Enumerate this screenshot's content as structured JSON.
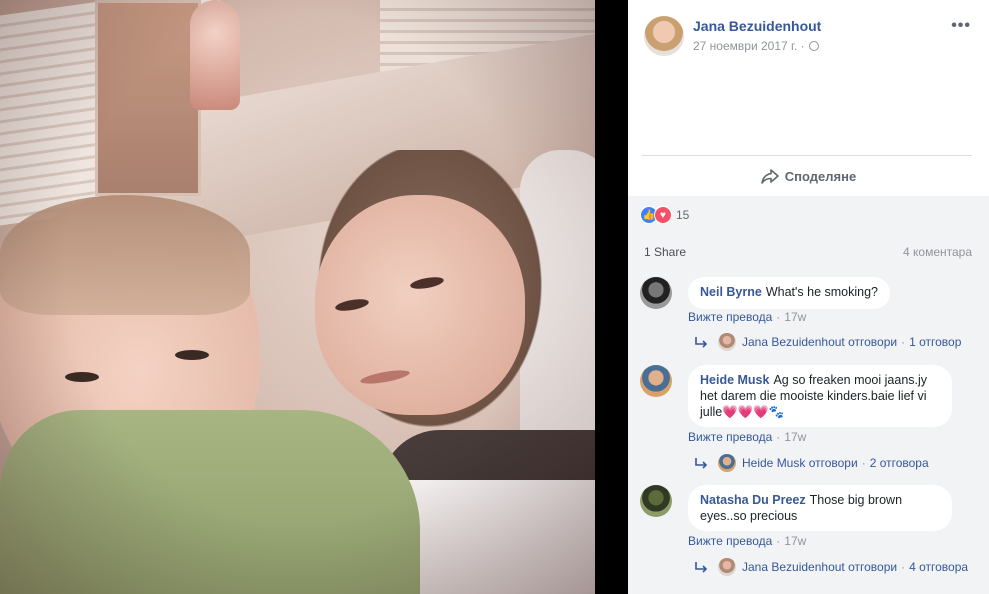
{
  "post": {
    "author": "Jana Bezuidenhout",
    "date": "27 ноември 2017 г. ·",
    "more_label": "•••",
    "share_label": "Споделяне",
    "reactions_count": "15",
    "shares": "1 Share",
    "comments_count": "4 коментара"
  },
  "comments": [
    {
      "name": "Neil Byrne",
      "text": "What's he smoking?",
      "action": "Вижте превода",
      "time": "17w",
      "reply_author": "Jana Bezuidenhout отговори",
      "reply_count": "1 отговор"
    },
    {
      "name": "Heide Musk",
      "text": "Ag so freaken mooi jaans.jy het darem die mooiste kinders.baie lief vi julle💗💗💗🐾",
      "action": "Вижте превода",
      "time": "17w",
      "reply_author": "Heide Musk отговори",
      "reply_count": "2 отговора"
    },
    {
      "name": "Natasha Du Preez",
      "text": "Those big brown eyes..so precious",
      "action": "Вижте превода",
      "time": "17w",
      "reply_author": "Jana Bezuidenhout отговори",
      "reply_count": "4 отговора"
    }
  ]
}
